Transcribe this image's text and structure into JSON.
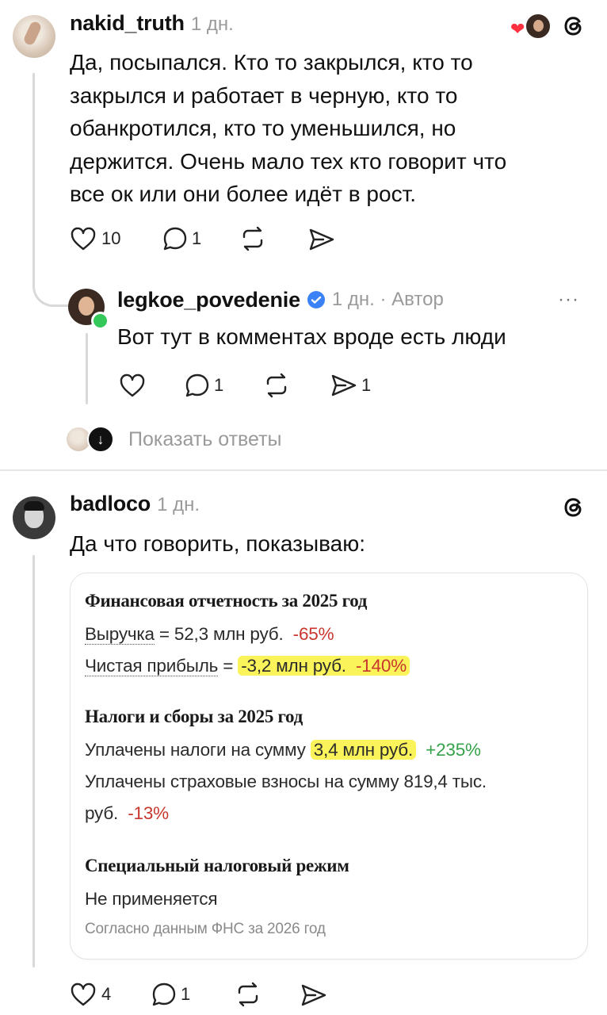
{
  "post1": {
    "username": "nakid_truth",
    "time": "1 дн.",
    "lines": [
      "Да, посыпался. Кто то закрылся, кто то",
      "закрылся и работает в черную, кто то",
      "обанкротился, кто то уменьшился, но",
      "держится. Очень мало тех кто говорит что",
      "все ок или они более идёт в рост."
    ],
    "likes": "10",
    "replies": "1"
  },
  "reply": {
    "username": "legkoe_povedenie",
    "time": "1 дн. · Автор",
    "text": "Вот тут в комментах вроде есть люди",
    "replies": "1",
    "shares": "1",
    "more": "···"
  },
  "show_replies": "Показать ответы",
  "post2": {
    "username": "badloco",
    "time": "1 дн.",
    "text": "Да что говорить, показываю:",
    "likes": "4",
    "replies": "1",
    "card": {
      "section1_title": "Финансовая отчетность за 2025 год",
      "revenue_label": "Выручка",
      "revenue_value": " = 52,3 млн руб.",
      "revenue_change": "-65%",
      "profit_label": "Чистая прибыль",
      "profit_eq": " = ",
      "profit_value": "-3,2 млн руб.",
      "profit_change": "-140%",
      "section2_title": "Налоги и сборы за 2025 год",
      "taxes_label": "Уплачены налоги на сумму ",
      "taxes_value": "3,4 млн руб.",
      "taxes_change": "+235%",
      "insurance_line1": "Уплачены страховые взносы на сумму 819,4 тыс.",
      "insurance_line2": "руб.",
      "insurance_change": "-13%",
      "section3_title": "Специальный налоговый режим",
      "regime_value": "Не применяется",
      "source": "Согласно данным ФНС за 2026 год"
    }
  },
  "colors": {
    "verified": "#3b82f6",
    "online": "#34c759",
    "heart": "#ff3040",
    "negative": "#c8372d",
    "positive": "#35a24a",
    "highlight": "#fbf35a"
  }
}
